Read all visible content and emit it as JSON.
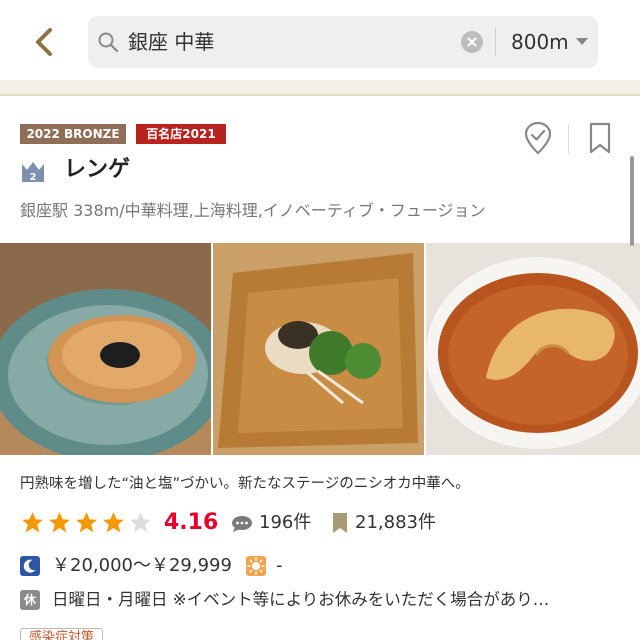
{
  "search": {
    "query": "銀座 中華",
    "distance": "800m"
  },
  "restaurant": {
    "badges": {
      "award": "2022 BRONZE",
      "hyakumeiten": "百名店2021"
    },
    "rank_number": "2",
    "name": "レンゲ",
    "info": "銀座駅 338m/中華料理,上海料理,イノベーティブ・フュージョン",
    "catchphrase": "円熟味を増した“油と塩”づかい。新たなステージのニシオカ中華へ。",
    "rating": {
      "stars_filled": 4,
      "stars_total": 5,
      "score": "4.16",
      "reviews": "196件",
      "saves": "21,883件"
    },
    "price": {
      "dinner": "￥20,000～￥29,999",
      "lunch": "-"
    },
    "holiday": {
      "icon_label": "休",
      "text": "日曜日・月曜日 ※イベント等によりお休みをいただく場合があり…"
    },
    "covid_tag": "感染症対策"
  },
  "colors": {
    "accent_gold": "#8a7245",
    "rating_red": "#e5002b",
    "star_orange": "#f39800",
    "bronze": "#8f6d56",
    "hyakumeiten_red": "#b8231e"
  },
  "icons": {
    "back": "chevron-left-icon",
    "search": "search-icon",
    "clear": "clear-icon",
    "visited": "visited-check-icon",
    "bookmark": "bookmark-icon",
    "crown": "crown-rank-icon",
    "review": "speech-bubble-icon",
    "save": "bookmark-count-icon",
    "dinner": "moon-icon",
    "lunch": "sun-icon"
  }
}
